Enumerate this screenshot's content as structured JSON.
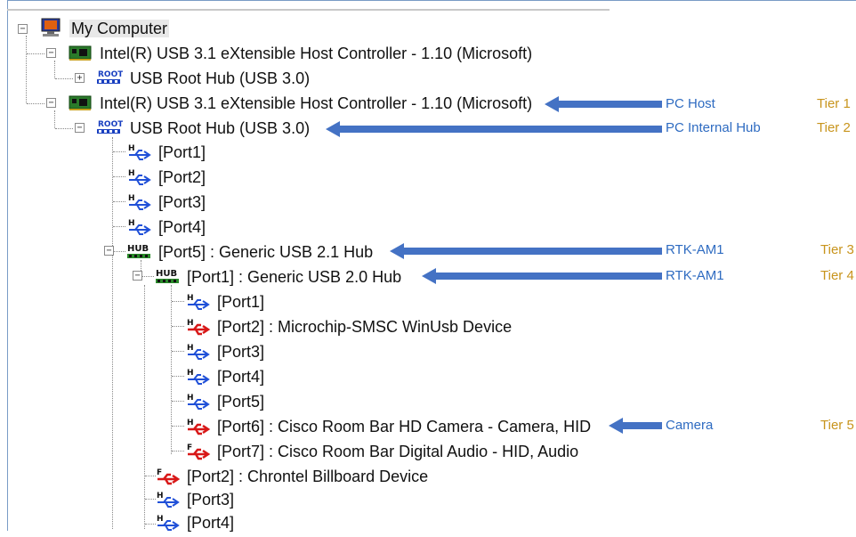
{
  "tree": {
    "root": "My Computer",
    "controller1": "Intel(R) USB 3.1 eXtensible Host Controller - 1.10 (Microsoft)",
    "roothub1": "USB Root Hub (USB 3.0)",
    "controller2": "Intel(R) USB 3.1 eXtensible Host Controller - 1.10 (Microsoft)",
    "roothub2": "USB Root Hub (USB 3.0)",
    "port1": "[Port1]",
    "port2": "[Port2]",
    "port3": "[Port3]",
    "port4": "[Port4]",
    "port5_hub": "[Port5] : Generic USB 2.1 Hub",
    "hub2": "[Port1] : Generic USB 2.0 Hub",
    "sub_port1": "[Port1]",
    "sub_port2": "[Port2] : Microchip-SMSC WinUsb Device",
    "sub_port3": "[Port3]",
    "sub_port4": "[Port4]",
    "sub_port5": "[Port5]",
    "sub_port6": "[Port6] : Cisco Room Bar HD Camera - Camera, HID",
    "sub_port7": "[Port7] : Cisco Room Bar Digital Audio - HID, Audio",
    "hub1_port2": "[Port2] : Chrontel Billboard Device",
    "hub1_port3": "[Port3]",
    "hub1_port4": "[Port4]"
  },
  "icons": {
    "root_text": "",
    "root_hub_text": "ROOT",
    "hub_text": "HUB",
    "usb_port_h": "H",
    "usb_port_f": "F"
  },
  "annotations": {
    "pc_host": "PC Host",
    "pc_internal_hub": "PC Internal Hub",
    "rtk1": "RTK-AM1",
    "rtk2": "RTK-AM1",
    "camera": "Camera",
    "tier1": "Tier 1",
    "tier2": "Tier 2",
    "tier3": "Tier 3",
    "tier4": "Tier 4",
    "tier5": "Tier 5"
  },
  "colors": {
    "annotation": "#2e6bc1",
    "tier": "#c8941c",
    "arrow": "#4472c4",
    "usb_blue": "#2050d8",
    "usb_red": "#d81818",
    "board_green": "#2a7a2a"
  }
}
